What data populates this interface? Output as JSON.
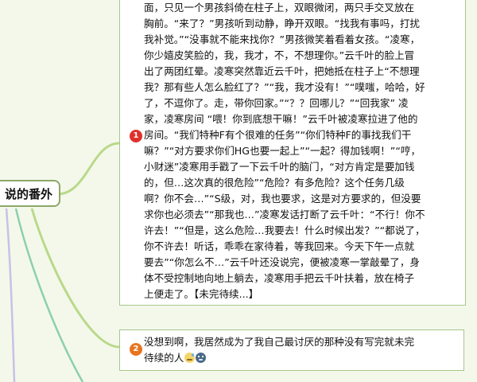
{
  "mindmap": {
    "root": {
      "label": "说的番外"
    },
    "nodes": [
      {
        "badge": "1",
        "badge_color": "#e0302a",
        "text": "面，只见一个男孩斜倚在柱子上，双眼微闭，两只手交叉放在\n胸前。“来了？”男孩听到动静，睁开双眼。“找我有事吗，打扰\n我补觉。”“没事就不能来找你？”男孩微笑着看着女孩。“凌寒，\n你少嬉皮笑脸的，我，我才，不，不想理你。”云千叶的脸上冒\n出了两团红晕。凌寒突然靠近云千叶，把她抵在柱子上“不想理\n我？那有些人怎么脸红了？”“我，我才没有！”“噗嗤，哈哈，好\n了，不逗你了。走，带你回家。”“？？回哪儿？”“回我家” 凌\n家，凌寒房间 “喂！你到底想干嘛！”云千叶被凌寒拉进了他的\n房间。“我们特种F有个很难的任务”“你们特种F的事找我们干\n嘛？”“对方要求你们HG也要一起上”“一起？得加钱啊！”“哼，\n小财迷”凌寒用手戳了一下云千叶的脑门，“对方肯定是要加钱\n的，但…这次真的很危险”“危险？有多危险？这个任务几级\n啊？你不会…”“S级，对，我也要求，这是对方要求的，但没要\n求你也必须去”“那我也…”凌寒发话打断了云千叶：“不行！你不\n许去！”“但是，这么危险…我要去！什么时候出发？”“都说了，\n你不许去！听话，乖乖在家待着，等我回来。今天下午一点就\n要去”“你怎么不…”云千叶还没说完，便被凌寒一掌敲晕了，身\n体不受控制地向地上躺去，凌寒用手把云千叶扶着，放在椅子\n上便走了。【未完待续...】"
      },
      {
        "badge": "2",
        "badge_color": "#e8741f",
        "text": "没想到啊，我居然成为了我自己最讨厌的那种没有写完就未完\n待续的人",
        "icons": [
          "sweat-smile-emoji-icon",
          "blue-face-emoji-icon"
        ]
      }
    ]
  },
  "colors": {
    "background": "#f4f8ea",
    "branch": "#b9d98a",
    "node_border": "#a9c58c"
  }
}
